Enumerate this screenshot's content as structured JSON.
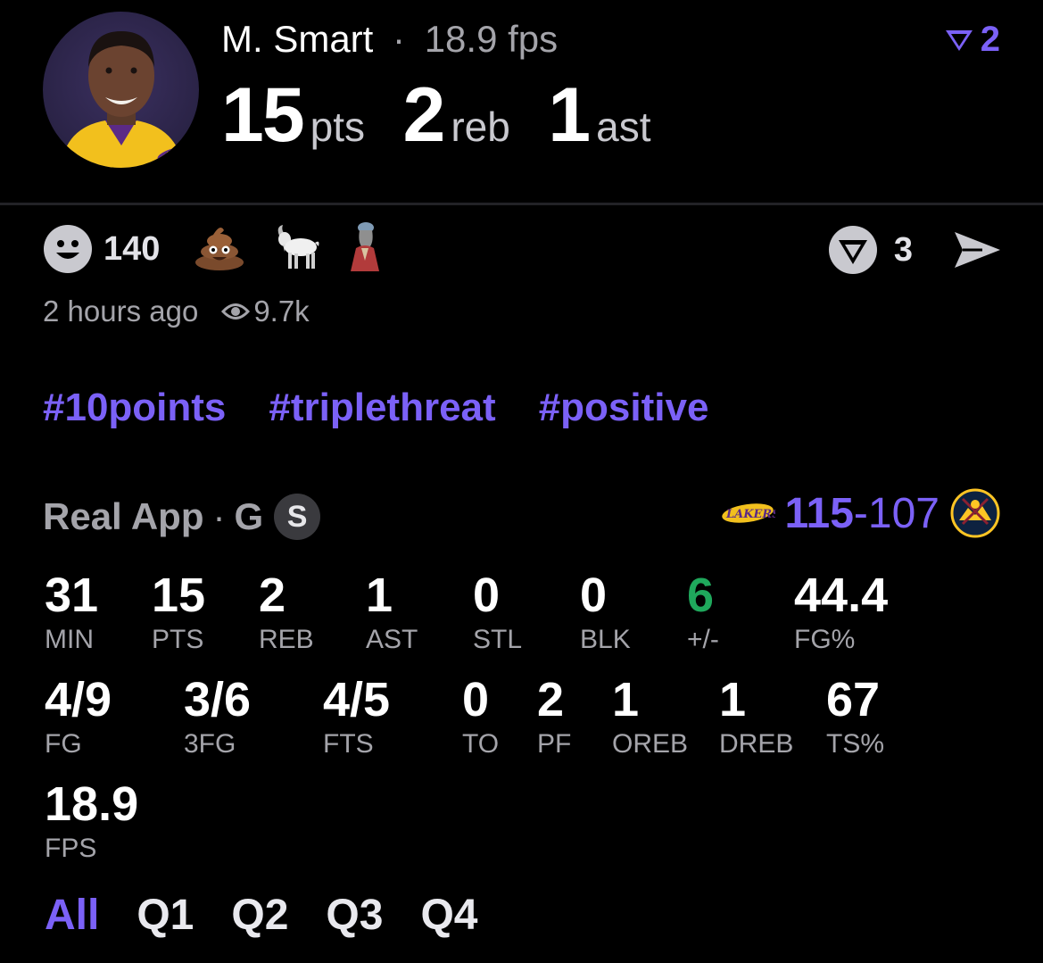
{
  "header": {
    "player_name": "M. Smart",
    "separator": "·",
    "fps_label": "18.9 fps",
    "stats": [
      {
        "value": "15",
        "unit": "pts"
      },
      {
        "value": "2",
        "unit": "reb"
      },
      {
        "value": "1",
        "unit": "ast"
      }
    ],
    "badge_count": "2",
    "accent": "#7b61f7"
  },
  "reactions": {
    "smiley_count": "140",
    "emojis": [
      "💩",
      "🐐",
      "🗿"
    ],
    "share_count": "3"
  },
  "meta": {
    "time": "2 hours ago",
    "views": "9.7k"
  },
  "tags": [
    "#10points",
    "#triplethreat",
    "#positive"
  ],
  "game": {
    "app": "Real App",
    "separator": "·",
    "position": "G",
    "badge": "S",
    "home_score": "115",
    "dash": "-",
    "away_score": "107"
  },
  "stats_row1": [
    {
      "value": "31",
      "label": "MIN"
    },
    {
      "value": "15",
      "label": "PTS"
    },
    {
      "value": "2",
      "label": "REB"
    },
    {
      "value": "1",
      "label": "AST"
    },
    {
      "value": "0",
      "label": "STL"
    },
    {
      "value": "0",
      "label": "BLK"
    },
    {
      "value": "6",
      "label": "+/-"
    },
    {
      "value": "44.4",
      "label": "FG%"
    }
  ],
  "stats_row2": [
    {
      "value": "4/9",
      "label": "FG"
    },
    {
      "value": "3/6",
      "label": "3FG"
    },
    {
      "value": "4/5",
      "label": "FTS"
    },
    {
      "value": "0",
      "label": "TO"
    },
    {
      "value": "2",
      "label": "PF"
    },
    {
      "value": "1",
      "label": "OREB"
    },
    {
      "value": "1",
      "label": "DREB"
    },
    {
      "value": "67",
      "label": "TS%"
    }
  ],
  "stats_row3": [
    {
      "value": "18.9",
      "label": "FPS"
    }
  ],
  "quarters": [
    "All",
    "Q1",
    "Q2",
    "Q3",
    "Q4"
  ],
  "active_quarter": "All"
}
